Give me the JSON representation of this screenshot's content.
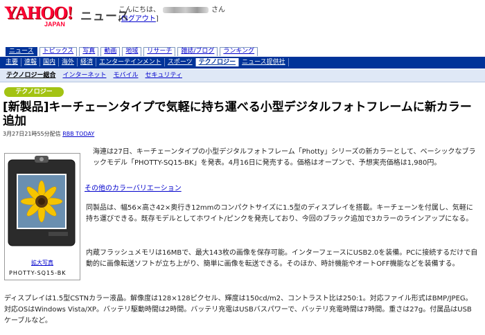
{
  "header": {
    "logo_text": "YAHOO!",
    "logo_sub": "JAPAN",
    "section": "ニュース",
    "greeting_prefix": "こんにちは、",
    "greeting_suffix": "さん",
    "logout_open": "[",
    "logout_label": "ログアウト",
    "logout_close": "]"
  },
  "tabs": [
    "ニュース",
    "トピックス",
    "写真",
    "動画",
    "地域",
    "リサーチ",
    "雑誌/ブログ",
    "ランキング"
  ],
  "subnav": [
    "主要",
    "速報",
    "国内",
    "海外",
    "経済",
    "エンターテインメント",
    "スポーツ",
    "テクノロジー",
    "ニュース提供社"
  ],
  "subnav2": [
    "テクノロジー総合",
    "インターネット",
    "モバイル",
    "セキュリティ"
  ],
  "category": "テクノロジー",
  "article": {
    "title": "[新製品]キーチェーンタイプで気軽に持ち運べる小型デジタルフォトフレームに新カラー追加",
    "date": "3月27日21時55分配信",
    "source": "RBB TODAY",
    "photo_link": "拡大写真",
    "photo_caption": "PHOTTY-SQ15-BK",
    "p1": "海連は27日、キーチェーンタイプの小型デジタルフォトフレーム「Photty」シリーズの新カラーとして、ベーシックなブラックモデル「PHOTTY-SQ15-BK」を発表。4月16日に発売する。価格はオープンで、予想実売価格は1,980円。",
    "link": "その他のカラーバリエーション",
    "p2": "同製品は、幅56×高さ42×奥行き12mmのコンパクトサイズに1.5型のディスプレイを搭載。キーチェーンを付属し、気軽に持ち運びできる。既存モデルとしてホワイト/ピンクを発売しており、今回のブラック追加で3カラーのラインアップになる。",
    "p3": "内蔵フラッシュメモリは16MBで、最大143枚の画像を保存可能。インターフェースにUSB2.0を装備。PCに接続するだけで自動的に画像転送ソフトが立ち上がり、簡単に画像を転送できる。そのほか、時計機能やオートOFF機能などを装備する。",
    "p4": "ディスプレイは1.5型CSTNカラー液晶。解像度は128×128ピクセル、輝度は150cd/m2、コントラスト比は250:1。対応ファイル形式はBMP/JPEG。対応OSはWindows Vista/XP。バッテリ駆動時間は2時間。バッテリ充電はUSBバスパワーで、バッテリ充電時間は7時間。重さは27g。付属品はUSBケーブルなど。"
  },
  "colors": {
    "yahoo_red": "#ff0033",
    "nav_blue": "#003399",
    "category_green": "#a3c313",
    "link_blue": "#0000cc"
  }
}
